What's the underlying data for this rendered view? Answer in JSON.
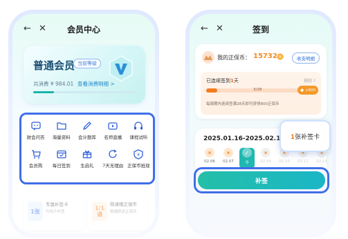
{
  "left": {
    "nav": {
      "title": "会员中心"
    },
    "member": {
      "level": "普通会员",
      "badge": "当前等级",
      "spend": "共消费 ¥ 984.01",
      "detail_link": "查看消费明细 >",
      "progress": 0.2
    },
    "features": [
      {
        "label": "财会问答",
        "icon": "chat-icon"
      },
      {
        "label": "海量资料",
        "icon": "folder-icon"
      },
      {
        "label": "会计题库",
        "icon": "pencil-icon"
      },
      {
        "label": "名师直播",
        "icon": "live-icon"
      },
      {
        "label": "课程试听",
        "icon": "headphones-icon"
      },
      {
        "label": "会员购",
        "icon": "cart-icon"
      },
      {
        "label": "每日签到",
        "icon": "calendar-icon"
      },
      {
        "label": "生启礼",
        "icon": "gift-icon"
      },
      {
        "label": "7天无理由",
        "icon": "refresh-icon"
      },
      {
        "label": "正保币抵现",
        "icon": "coin-icon"
      }
    ],
    "promos": [
      {
        "badge": "1张",
        "title": "专属补签卡",
        "subtitle": "可用于补签"
      },
      {
        "badge": "1/1通",
        "title": "购课赠正保币",
        "subtitle": "购课即送正保币"
      }
    ]
  },
  "right": {
    "nav": {
      "title": "签到"
    },
    "coins": {
      "label": "我的正保币：",
      "value": "15732",
      "rules_button": "收支明细"
    },
    "streak": {
      "prefix": "已连续签到",
      "days": "1",
      "suffix": "天",
      "rules": "规则 ?",
      "count": "3/28",
      "progress": 0.107,
      "reward": "+800",
      "note": "每周期内连续签满28天即可获得800正保币"
    },
    "calendar": {
      "range": "2025.01.16-2025.02.12",
      "days": [
        {
          "date": "02.06",
          "state": "signed"
        },
        {
          "date": "02.07",
          "state": "signed"
        },
        {
          "date": "今",
          "state": "today"
        },
        {
          "date": "02.09",
          "state": "future"
        },
        {
          "date": "02.10",
          "state": "future"
        },
        {
          "date": "02.11",
          "state": "future"
        },
        {
          "date": "02.12",
          "state": "future"
        }
      ]
    },
    "supplement": {
      "count": "1",
      "label": "张补签卡",
      "button": "补签"
    }
  },
  "colors": {
    "accent_blue": "#3f6ee8",
    "teal": "#1bb6c7",
    "orange": "#f07a1a"
  }
}
